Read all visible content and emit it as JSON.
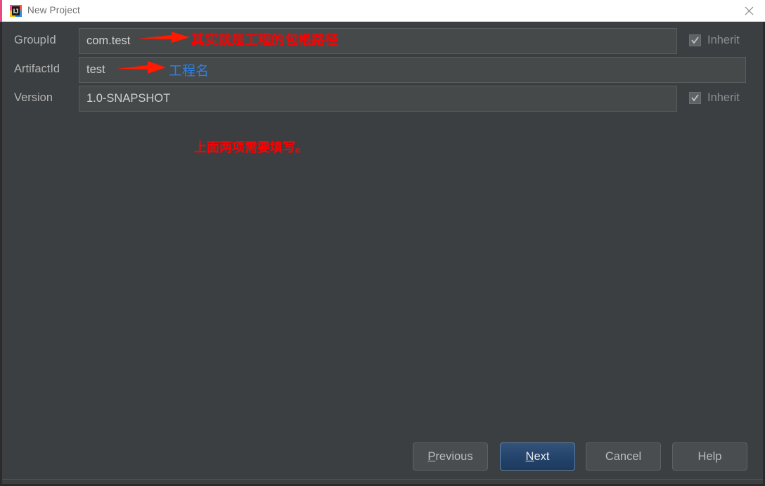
{
  "window": {
    "title": "New Project",
    "app_icon": "intellij-idea-icon",
    "close_icon": "close-icon",
    "background_color": "#3c3f41",
    "titlebar_background": "#ffffff"
  },
  "form": {
    "fields": [
      {
        "label": "GroupId",
        "value": "com.test",
        "has_inherit": true,
        "inherit_label": "Inherit",
        "inherit_checked": true
      },
      {
        "label": "ArtifactId",
        "value": "test",
        "has_inherit": false,
        "inherit_label": "",
        "inherit_checked": false
      },
      {
        "label": "Version",
        "value": "1.0-SNAPSHOT",
        "has_inherit": true,
        "inherit_label": "Inherit",
        "inherit_checked": true
      }
    ]
  },
  "annotations": [
    {
      "text": "其实就是工程的包根路径",
      "color": "#ff0000",
      "arrow": "red-arrow-right"
    },
    {
      "text": "工程名",
      "color": "#2f7fe0",
      "arrow": "red-arrow-right"
    },
    {
      "text": "上面两项需要填写。",
      "color": "#ff0000",
      "arrow": "none"
    }
  ],
  "buttons": {
    "previous": {
      "label": "Previous",
      "mnemonic": "P",
      "rest": "revious",
      "primary": false
    },
    "next": {
      "label": "Next",
      "mnemonic": "N",
      "rest": "ext",
      "primary": true
    },
    "cancel": {
      "label": "Cancel",
      "primary": false
    },
    "help": {
      "label": "Help",
      "primary": false
    }
  },
  "colors": {
    "dialog_background": "#3c3f41",
    "input_background": "#45494a",
    "input_border": "#5a5d5e",
    "label_text": "#b2b2b2",
    "value_text": "#cfcfcf",
    "primary_button": "#24436a",
    "annotation_red": "#ff0000",
    "annotation_blue": "#2f7fe0"
  }
}
